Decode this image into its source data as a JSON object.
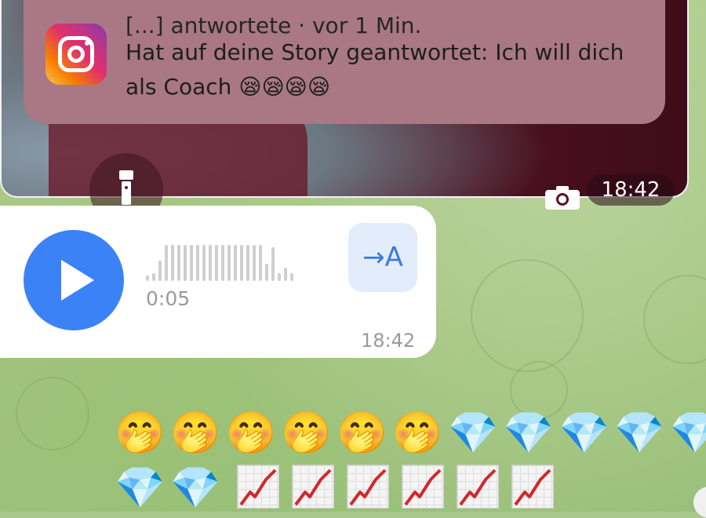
{
  "notification": {
    "cut_line": "[...] antwortete · vor 1 Min.",
    "line1": "Hat auf deine Story geantwortet: Ich will dich",
    "line2": "als Coach 😪😪😪😪"
  },
  "photo_message": {
    "time": "18:42",
    "icons": [
      "flashlight-icon",
      "camera-icon",
      "instagram-icon"
    ]
  },
  "voice_message": {
    "duration": "0:05",
    "time": "18:42",
    "transcribe_label": "→A",
    "waveform": [
      0.15,
      0.2,
      0.55,
      0.95,
      0.95,
      0.95,
      0.95,
      0.95,
      0.95,
      0.95,
      0.95,
      0.95,
      0.95,
      0.95,
      0.95,
      0.95,
      0.95,
      0.95,
      0.95,
      0.45,
      0.9,
      0.2,
      0.35,
      0.2
    ]
  },
  "emoji_rows": {
    "row1": "🤭🤭🤭🤭🤭🤭💎💎💎💎💎",
    "row2": "💎💎"
  },
  "chart_emoji_count": 6,
  "colors": {
    "play_blue": "#3b82f6",
    "transcribe_bg": "#e3ecfb",
    "notification_bg": "#a97884"
  }
}
